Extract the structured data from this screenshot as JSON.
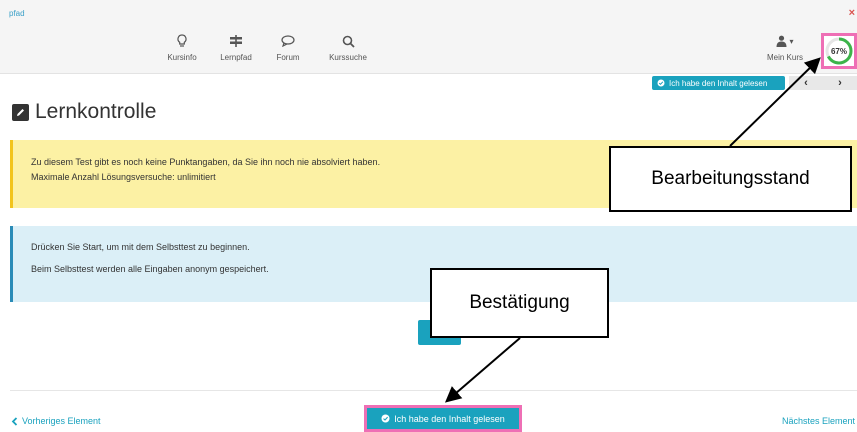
{
  "header": {
    "brand": "pfad",
    "close_glyph": "×",
    "nav": [
      {
        "label": "Kursinfo",
        "icon": "lightbulb-icon"
      },
      {
        "label": "Lernpfad",
        "icon": "signpost-icon"
      },
      {
        "label": "Forum",
        "icon": "chat-icon"
      },
      {
        "label": "Kurssuche",
        "icon": "search-icon"
      }
    ],
    "user_menu": {
      "label": "Mein Kurs",
      "icon": "user-icon",
      "caret": "▾"
    },
    "progress": {
      "percent_label": "67%",
      "value": 0.67
    }
  },
  "toolbar": {
    "read_label": "Ich habe den Inhalt gelesen",
    "prev_glyph": "‹",
    "next_glyph": "›"
  },
  "page": {
    "title": "Lernkontrolle",
    "warning_lines": [
      "Zu diesem Test gibt es noch keine Punktangaben, da Sie ihn noch nie absolviert haben.",
      "Maximale Anzahl Lösungsversuche: unlimitiert"
    ],
    "info_lines": [
      "Drücken Sie Start, um mit dem Selbsttest zu beginnen.",
      "Beim Selbsttest werden alle Eingaben anonym gespeichert."
    ]
  },
  "footer": {
    "prev_label": "Vorheriges Element",
    "next_label": "Nächstes Element",
    "read_label": "Ich habe den Inhalt gelesen"
  },
  "annotations": {
    "callout_status": "Bearbeitungsstand",
    "callout_confirm": "Bestätigung"
  },
  "colors": {
    "accent": "#1aa2be",
    "highlight": "#ee6fb5",
    "progress_ring": "#3cb44a",
    "warning_bg": "#fcf1a4",
    "info_bg": "#dbeff7"
  }
}
